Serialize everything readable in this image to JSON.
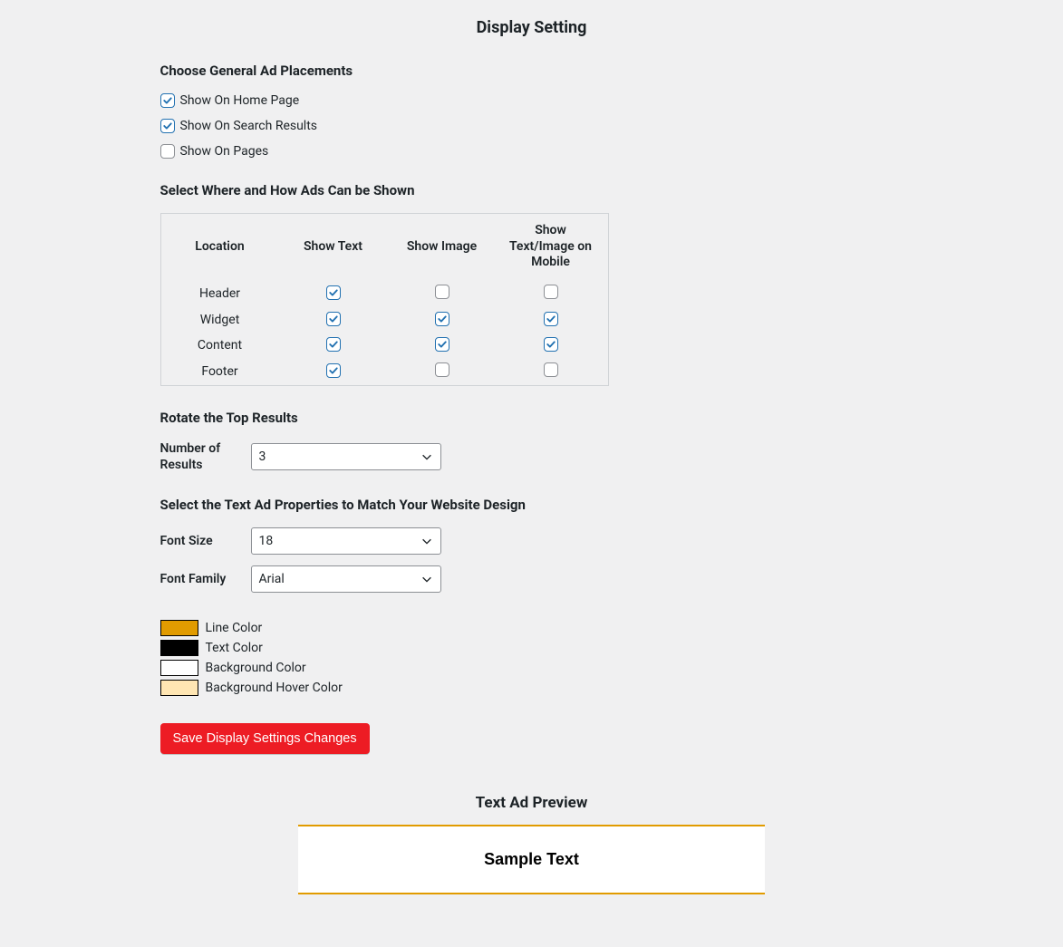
{
  "title": "Display Setting",
  "placements": {
    "heading": "Choose General Ad Placements",
    "items": [
      {
        "label": "Show On Home Page",
        "checked": true
      },
      {
        "label": "Show On Search Results",
        "checked": true
      },
      {
        "label": "Show On Pages",
        "checked": false
      }
    ]
  },
  "locations": {
    "heading": "Select Where and How Ads Can be Shown",
    "columns": [
      "Location",
      "Show Text",
      "Show Image",
      "Show Text/Image on Mobile"
    ],
    "rows": [
      {
        "name": "Header",
        "text": true,
        "image": false,
        "mobile": false
      },
      {
        "name": "Widget",
        "text": true,
        "image": true,
        "mobile": true
      },
      {
        "name": "Content",
        "text": true,
        "image": true,
        "mobile": true
      },
      {
        "name": "Footer",
        "text": true,
        "image": false,
        "mobile": false
      }
    ]
  },
  "rotate": {
    "heading": "Rotate the Top Results",
    "label": "Number of Results",
    "value": "3"
  },
  "textad": {
    "heading": "Select the Text Ad Properties to Match Your Website Design",
    "font_size_label": "Font Size",
    "font_size_value": "18",
    "font_family_label": "Font Family",
    "font_family_value": "Arial"
  },
  "colors": {
    "line": {
      "label": "Line Color",
      "hex": "#e19b00"
    },
    "text": {
      "label": "Text Color",
      "hex": "#000000"
    },
    "bg": {
      "label": "Background Color",
      "hex": "#ffffff"
    },
    "hover": {
      "label": "Background Hover Color",
      "hex": "#ffe6b3"
    }
  },
  "save_label": "Save Display Settings Changes",
  "preview": {
    "heading": "Text Ad Preview",
    "sample": "Sample Text"
  }
}
